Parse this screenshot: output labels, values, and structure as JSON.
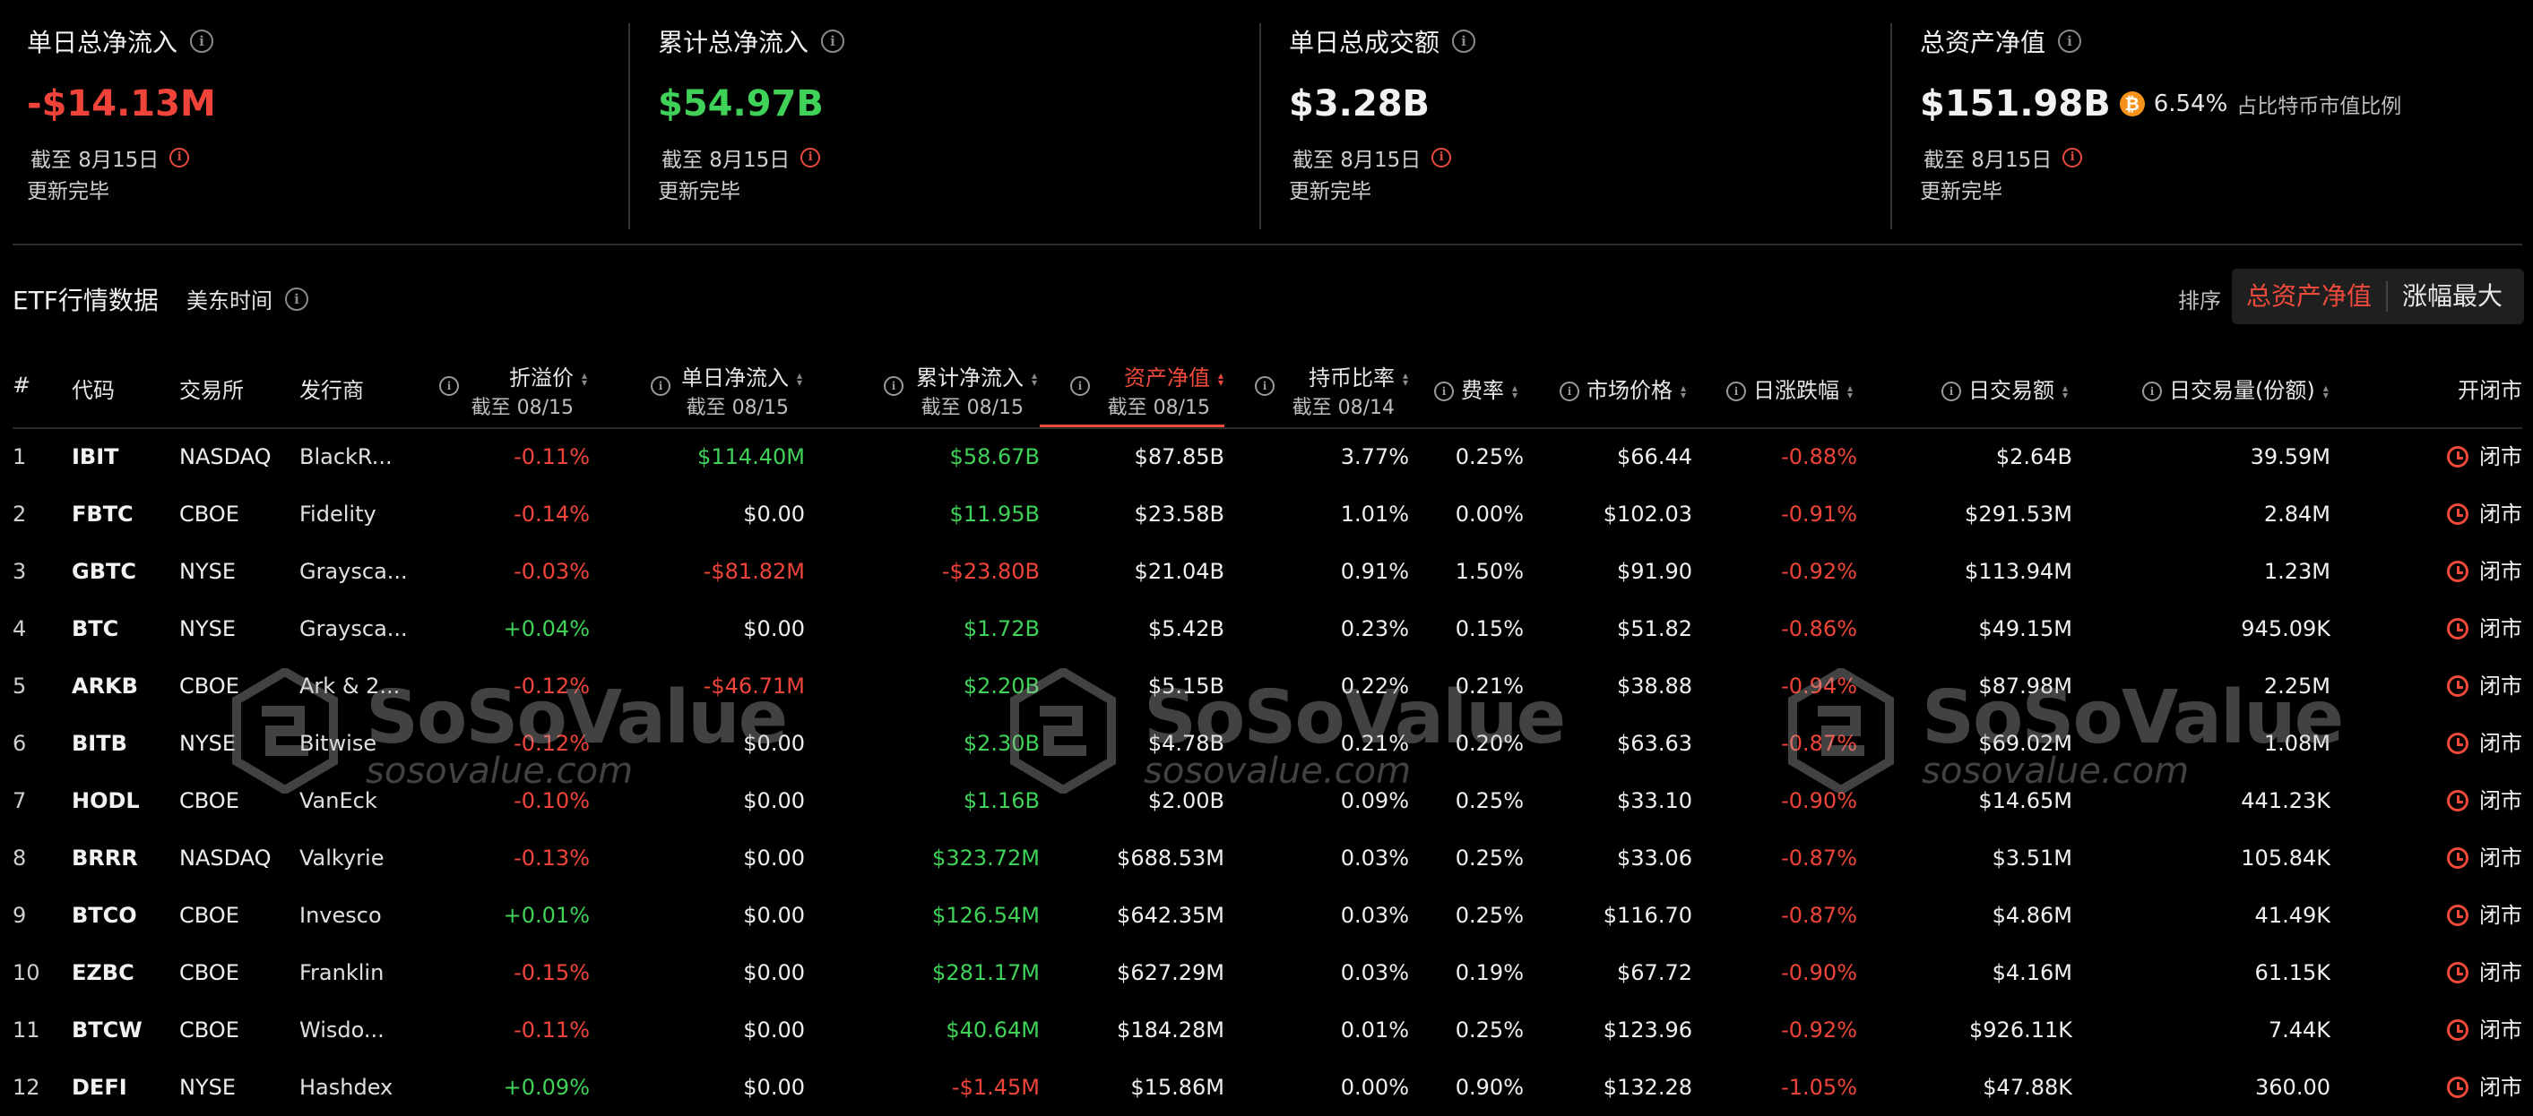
{
  "summary": {
    "cards": [
      {
        "title": "单日总净流入",
        "value": "-$14.13M",
        "date": "截至 8月15日",
        "status": "更新完毕"
      },
      {
        "title": "累计总净流入",
        "value": "$54.97B",
        "date": "截至 8月15日",
        "status": "更新完毕"
      },
      {
        "title": "单日总成交额",
        "value": "$3.28B",
        "date": "截至 8月15日",
        "status": "更新完毕"
      },
      {
        "title": "总资产净值",
        "value": "$151.98B",
        "btc_pct": "6.54%",
        "btc_pct_label": "占比特币市值比例",
        "date": "截至 8月15日",
        "status": "更新完毕"
      }
    ]
  },
  "toolbar": {
    "title": "ETF行情数据",
    "timezone": "美东时间",
    "sort_label": "排序",
    "sort_active": "总资产净值",
    "sort_other": "涨幅最大"
  },
  "table": {
    "headers": {
      "num": "#",
      "code": "代码",
      "exchange": "交易所",
      "issuer": "发行商",
      "premium": "折溢价",
      "premium_sub": "截至 08/15",
      "daily_flow": "单日净流入",
      "daily_flow_sub": "截至 08/15",
      "cum_flow": "累计净流入",
      "cum_flow_sub": "截至 08/15",
      "nav": "资产净值",
      "nav_sub": "截至 08/15",
      "holding": "持币比率",
      "holding_sub": "截至 08/14",
      "fee": "费率",
      "price": "市场价格",
      "change": "日涨跌幅",
      "trade_value": "日交易额",
      "volume": "日交易量(份额)",
      "status": "开闭市"
    },
    "rows": [
      {
        "num": "1",
        "code": "IBIT",
        "exchange": "NASDAQ",
        "issuer": "BlackR...",
        "premium": "-0.11%",
        "daily_flow": "$114.40M",
        "cum_flow": "$58.67B",
        "nav": "$87.85B",
        "holding": "3.77%",
        "fee": "0.25%",
        "price": "$66.44",
        "change": "-0.88%",
        "trade_value": "$2.64B",
        "volume": "39.59M",
        "status": "闭市"
      },
      {
        "num": "2",
        "code": "FBTC",
        "exchange": "CBOE",
        "issuer": "Fidelity",
        "premium": "-0.14%",
        "daily_flow": "$0.00",
        "cum_flow": "$11.95B",
        "nav": "$23.58B",
        "holding": "1.01%",
        "fee": "0.00%",
        "price": "$102.03",
        "change": "-0.91%",
        "trade_value": "$291.53M",
        "volume": "2.84M",
        "status": "闭市"
      },
      {
        "num": "3",
        "code": "GBTC",
        "exchange": "NYSE",
        "issuer": "Graysca...",
        "premium": "-0.03%",
        "daily_flow": "-$81.82M",
        "cum_flow": "-$23.80B",
        "nav": "$21.04B",
        "holding": "0.91%",
        "fee": "1.50%",
        "price": "$91.90",
        "change": "-0.92%",
        "trade_value": "$113.94M",
        "volume": "1.23M",
        "status": "闭市"
      },
      {
        "num": "4",
        "code": "BTC",
        "exchange": "NYSE",
        "issuer": "Graysca...",
        "premium": "+0.04%",
        "daily_flow": "$0.00",
        "cum_flow": "$1.72B",
        "nav": "$5.42B",
        "holding": "0.23%",
        "fee": "0.15%",
        "price": "$51.82",
        "change": "-0.86%",
        "trade_value": "$49.15M",
        "volume": "945.09K",
        "status": "闭市"
      },
      {
        "num": "5",
        "code": "ARKB",
        "exchange": "CBOE",
        "issuer": "Ark & 2...",
        "premium": "-0.12%",
        "daily_flow": "-$46.71M",
        "cum_flow": "$2.20B",
        "nav": "$5.15B",
        "holding": "0.22%",
        "fee": "0.21%",
        "price": "$38.88",
        "change": "-0.94%",
        "trade_value": "$87.98M",
        "volume": "2.25M",
        "status": "闭市"
      },
      {
        "num": "6",
        "code": "BITB",
        "exchange": "NYSE",
        "issuer": "Bitwise",
        "premium": "-0.12%",
        "daily_flow": "$0.00",
        "cum_flow": "$2.30B",
        "nav": "$4.78B",
        "holding": "0.21%",
        "fee": "0.20%",
        "price": "$63.63",
        "change": "-0.87%",
        "trade_value": "$69.02M",
        "volume": "1.08M",
        "status": "闭市"
      },
      {
        "num": "7",
        "code": "HODL",
        "exchange": "CBOE",
        "issuer": "VanEck",
        "premium": "-0.10%",
        "daily_flow": "$0.00",
        "cum_flow": "$1.16B",
        "nav": "$2.00B",
        "holding": "0.09%",
        "fee": "0.25%",
        "price": "$33.10",
        "change": "-0.90%",
        "trade_value": "$14.65M",
        "volume": "441.23K",
        "status": "闭市"
      },
      {
        "num": "8",
        "code": "BRRR",
        "exchange": "NASDAQ",
        "issuer": "Valkyrie",
        "premium": "-0.13%",
        "daily_flow": "$0.00",
        "cum_flow": "$323.72M",
        "nav": "$688.53M",
        "holding": "0.03%",
        "fee": "0.25%",
        "price": "$33.06",
        "change": "-0.87%",
        "trade_value": "$3.51M",
        "volume": "105.84K",
        "status": "闭市"
      },
      {
        "num": "9",
        "code": "BTCO",
        "exchange": "CBOE",
        "issuer": "Invesco",
        "premium": "+0.01%",
        "daily_flow": "$0.00",
        "cum_flow": "$126.54M",
        "nav": "$642.35M",
        "holding": "0.03%",
        "fee": "0.25%",
        "price": "$116.70",
        "change": "-0.87%",
        "trade_value": "$4.86M",
        "volume": "41.49K",
        "status": "闭市"
      },
      {
        "num": "10",
        "code": "EZBC",
        "exchange": "CBOE",
        "issuer": "Franklin",
        "premium": "-0.15%",
        "daily_flow": "$0.00",
        "cum_flow": "$281.17M",
        "nav": "$627.29M",
        "holding": "0.03%",
        "fee": "0.19%",
        "price": "$67.72",
        "change": "-0.90%",
        "trade_value": "$4.16M",
        "volume": "61.15K",
        "status": "闭市"
      },
      {
        "num": "11",
        "code": "BTCW",
        "exchange": "CBOE",
        "issuer": "Wisdo...",
        "premium": "-0.11%",
        "daily_flow": "$0.00",
        "cum_flow": "$40.64M",
        "nav": "$184.28M",
        "holding": "0.01%",
        "fee": "0.25%",
        "price": "$123.96",
        "change": "-0.92%",
        "trade_value": "$926.11K",
        "volume": "7.44K",
        "status": "闭市"
      },
      {
        "num": "12",
        "code": "DEFI",
        "exchange": "NYSE",
        "issuer": "Hashdex",
        "premium": "+0.09%",
        "daily_flow": "$0.00",
        "cum_flow": "-$1.45M",
        "nav": "$15.86M",
        "holding": "0.00%",
        "fee": "0.90%",
        "price": "$132.28",
        "change": "-1.05%",
        "trade_value": "$47.88K",
        "volume": "360.00",
        "status": "闭市"
      }
    ]
  },
  "watermark": {
    "brand": "SoSoValue",
    "url": "sosovalue.com"
  },
  "colors": {
    "negative": "#f0443a",
    "positive": "#3fd158",
    "accent": "#ef4a3c",
    "bitcoin": "#f7931a"
  }
}
